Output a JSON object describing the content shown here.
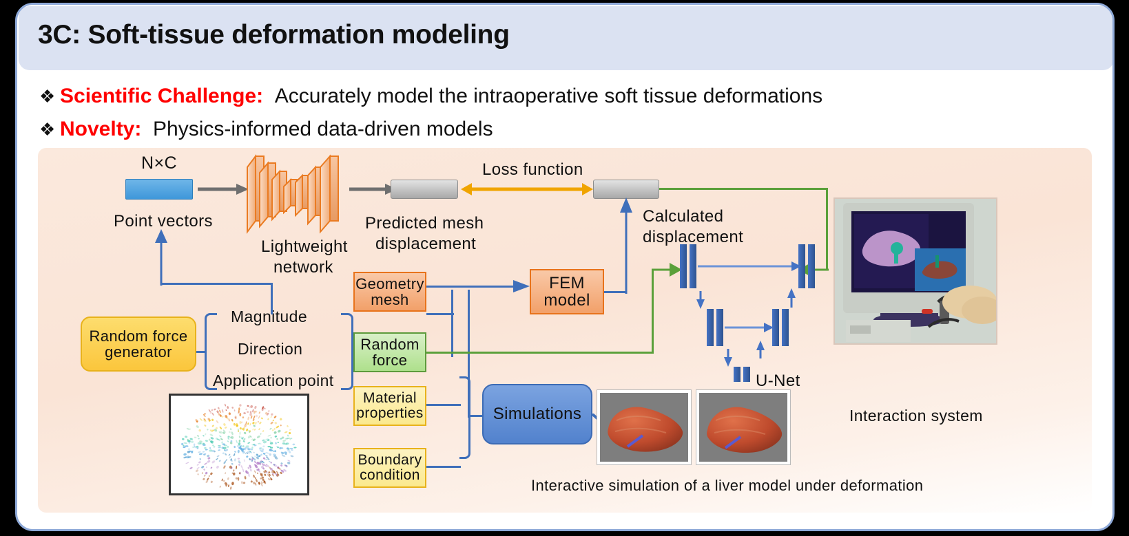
{
  "header": {
    "title": "3C: Soft-tissue deformation modeling"
  },
  "bullets": [
    {
      "marker": "❖",
      "key": "Scientific Challenge:",
      "value": "Accurately model the intraoperative soft tissue deformations"
    },
    {
      "marker": "❖",
      "key": "Novelty:",
      "value": "Physics-informed data-driven models"
    }
  ],
  "diagram": {
    "nxc_label": "N×C",
    "point_vectors_label": "Point vectors",
    "lightweight_network_label_line1": "Lightweight",
    "lightweight_network_label_line2": "network",
    "predicted_mesh_line1": "Predicted mesh",
    "predicted_mesh_line2": "displacement",
    "loss_function_label": "Loss function",
    "calculated_line1": "Calculated",
    "calculated_line2": "displacement",
    "fem_line1": "FEM",
    "fem_line2": "model",
    "unet_label": "U-Net",
    "random_force_generator_line1": "Random force",
    "random_force_generator_line2": "generator",
    "param_magnitude": "Magnitude",
    "param_direction": "Direction",
    "param_application_point": "Application point",
    "geometry_mesh_line1": "Geometry",
    "geometry_mesh_line2": "mesh",
    "random_force_line1": "Random",
    "random_force_line2": "force",
    "material_properties_line1": "Material",
    "material_properties_line2": "properties",
    "boundary_condition_line1": "Boundary",
    "boundary_condition_line2": "condition",
    "simulations_label": "Simulations",
    "liver_caption": "Interactive simulation of a liver model under deformation",
    "interaction_caption": "Interaction system"
  },
  "colors": {
    "header_bg": "#dbe2f2",
    "frame_border": "#8ea9d8",
    "accent_red": "#ff0000",
    "panel_bg": "#fae4d6",
    "blue_arrow": "#3f6fba",
    "green_arrow": "#5aa03a",
    "gold_arrow": "#f0a400",
    "gray_arrow": "#6f6f6f",
    "orange_box": "#e8731b",
    "green_box": "#5d9b3c",
    "yellow_box": "#e8b21b"
  }
}
